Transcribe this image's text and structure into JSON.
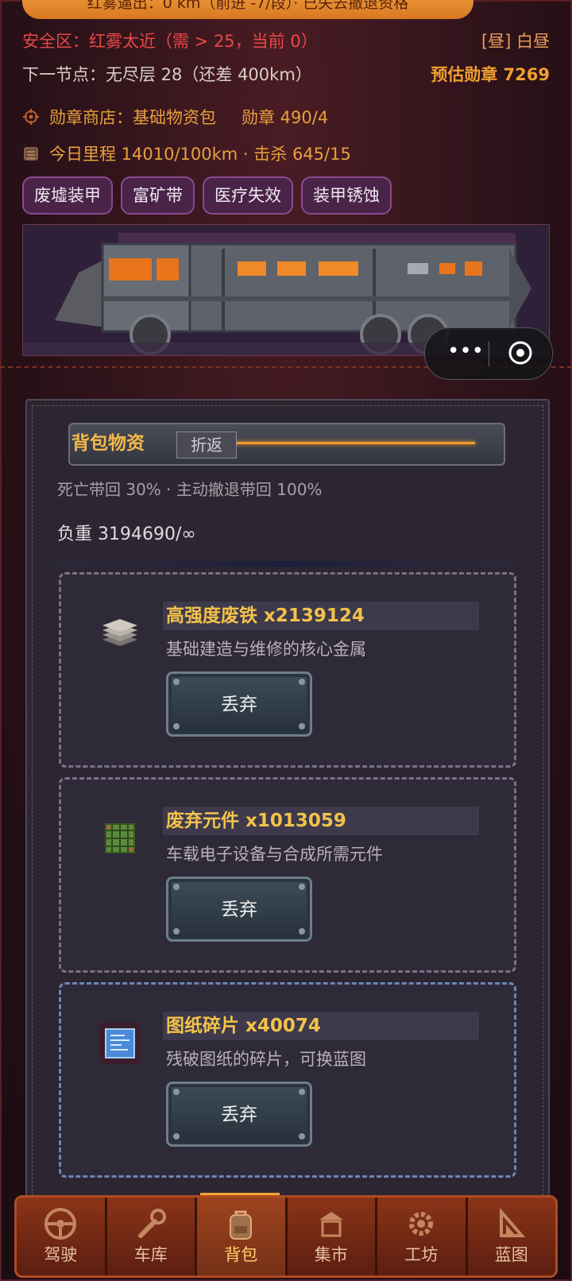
{
  "top_banner": {
    "text": "红雾逼出：0 km（前进 -7/段）· 已失去撤退资格"
  },
  "status": {
    "safe_zone": "安全区：红雾太近（需 > 25，当前 0）",
    "time_of_day": "[昼] 白昼",
    "next_node": "下一节点：无尽层 28（还差 400km）",
    "medal_estimate": "预估勋章 7269"
  },
  "shop": {
    "label": "勋章商店：基础物资包",
    "medals": "勋章 490/4"
  },
  "mileage": {
    "text": "今日里程 14010/100km · 击杀 645/15"
  },
  "tags": [
    "废墟装甲",
    "富矿带",
    "医疗失效",
    "装甲锈蚀"
  ],
  "capsule": {
    "more_icon": "more-dots-icon",
    "close_icon": "target-icon"
  },
  "backpack": {
    "title": "背包物资",
    "return_tag": "折返",
    "recovery": "死亡带回 30% · 主动撤退带回 100%",
    "weight": "负重 3194690/∞"
  },
  "items": [
    {
      "name": "高强度废铁 x2139124",
      "desc": "基础建造与维修的核心金属",
      "button": "丢弃",
      "icon": "scrap-metal-icon"
    },
    {
      "name": "废弃元件 x1013059",
      "desc": "车载电子设备与合成所需元件",
      "button": "丢弃",
      "icon": "circuit-chip-icon"
    },
    {
      "name": "图纸碎片 x40074",
      "desc": "残破图纸的碎片，可换蓝图",
      "button": "丢弃",
      "icon": "blueprint-icon"
    }
  ],
  "nav": [
    {
      "label": "驾驶",
      "icon": "steering-wheel-icon"
    },
    {
      "label": "车库",
      "icon": "wrench-icon"
    },
    {
      "label": "背包",
      "icon": "backpack-icon"
    },
    {
      "label": "集市",
      "icon": "market-icon"
    },
    {
      "label": "工坊",
      "icon": "gear-icon"
    },
    {
      "label": "蓝图",
      "icon": "blueprint-tool-icon"
    }
  ],
  "colors": {
    "accent": "#f29a2e",
    "danger": "#e84848",
    "medal": "#f0a030",
    "tag_border": "#8a4a90"
  }
}
